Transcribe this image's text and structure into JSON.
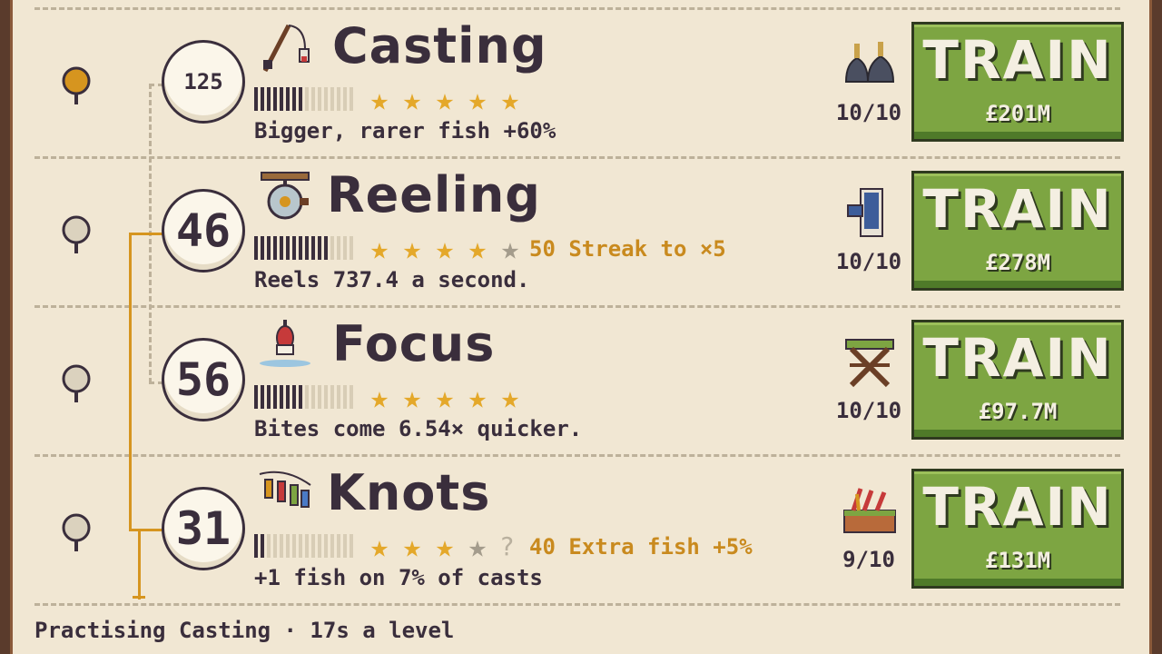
{
  "skills": [
    {
      "name": "Casting",
      "level": "125",
      "stars_filled": 5,
      "stars_total": 5,
      "bar_filled": 8,
      "bar_total": 16,
      "bonus": "",
      "description": "Bigger, rarer fish +60%",
      "count": "10/10",
      "train_label": "TRAIN",
      "price": "£201M",
      "pin_active": true,
      "icon": "fishing-rod-icon",
      "item_icon": "ink-bottles-icon"
    },
    {
      "name": "Reeling",
      "level": "46",
      "stars_filled": 4,
      "stars_total": 5,
      "bar_filled": 12,
      "bar_total": 16,
      "bonus": "50 Streak to ×5",
      "description": "Reels 737.4 a second.",
      "count": "10/10",
      "train_label": "TRAIN",
      "price": "£278M",
      "pin_active": false,
      "icon": "reel-icon",
      "item_icon": "glove-icon"
    },
    {
      "name": "Focus",
      "level": "56",
      "stars_filled": 5,
      "stars_total": 5,
      "bar_filled": 8,
      "bar_total": 16,
      "bonus": "",
      "description": "Bites come 6.54× quicker.",
      "count": "10/10",
      "train_label": "TRAIN",
      "price": "£97.7M",
      "pin_active": false,
      "icon": "bobber-icon",
      "item_icon": "stool-icon"
    },
    {
      "name": "Knots",
      "level": "31",
      "stars_filled": 3,
      "stars_total": 4,
      "bar_filled": 2,
      "bar_total": 16,
      "bonus": "40 Extra fish +5%",
      "description": "+1 fish on 7% of casts",
      "count": "9/10",
      "train_label": "TRAIN",
      "price": "£131M",
      "pin_active": false,
      "icon": "lures-icon",
      "item_icon": "tackle-box-icon"
    }
  ],
  "status": "Practising Casting · 17s a level",
  "colors": {
    "background": "#f1e7d3",
    "text": "#3a2e3c",
    "accent": "#d6951f",
    "button": "#7da542",
    "star": "#e4a82a",
    "bonus": "#c98a1e"
  }
}
